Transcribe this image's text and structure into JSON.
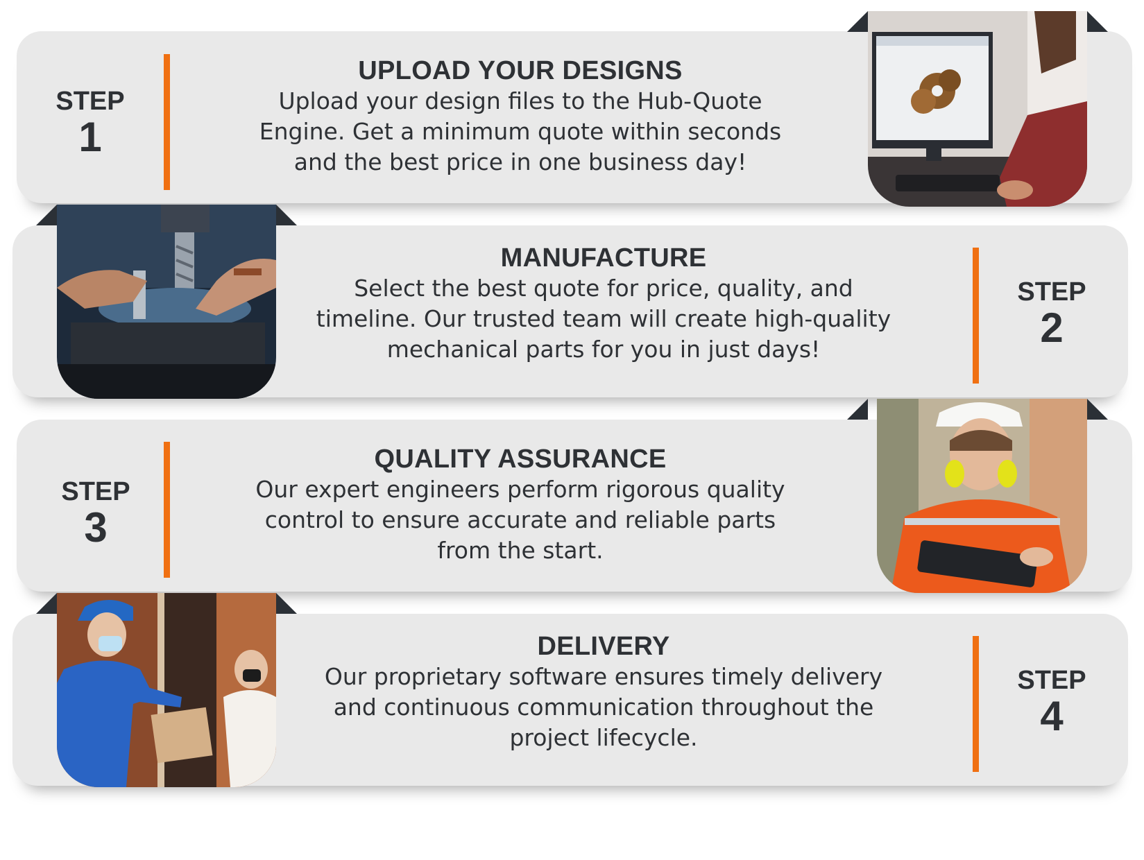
{
  "steps": [
    {
      "step_word": "STEP",
      "number": "1",
      "title": "UPLOAD YOUR DESIGNS",
      "lines": [
        "Upload your design files to the Hub-Quote",
        "Engine. Get a minimum quote within seconds",
        "and the best price in one business day!"
      ],
      "image_icon": "cad-computer-photo"
    },
    {
      "step_word": "STEP",
      "number": "2",
      "title": "MANUFACTURE",
      "lines": [
        "Select the best quote for price, quality, and",
        "timeline. Our trusted team will create high-quality",
        "mechanical parts for you in just days!"
      ],
      "image_icon": "cnc-machining-photo"
    },
    {
      "step_word": "STEP",
      "number": "3",
      "title": "QUALITY ASSURANCE",
      "lines": [
        "Our expert engineers perform rigorous quality",
        "control to ensure accurate and reliable parts",
        "from the start."
      ],
      "image_icon": "engineer-tablet-photo"
    },
    {
      "step_word": "STEP",
      "number": "4",
      "title": "DELIVERY",
      "lines": [
        "Our proprietary software ensures timely delivery",
        "and continuous communication throughout the",
        "project lifecycle."
      ],
      "image_icon": "courier-delivery-photo"
    }
  ],
  "colors": {
    "accent": "#f07012",
    "card": "#e9e9e9",
    "text": "#2e3135",
    "dark": "#2b3036"
  }
}
